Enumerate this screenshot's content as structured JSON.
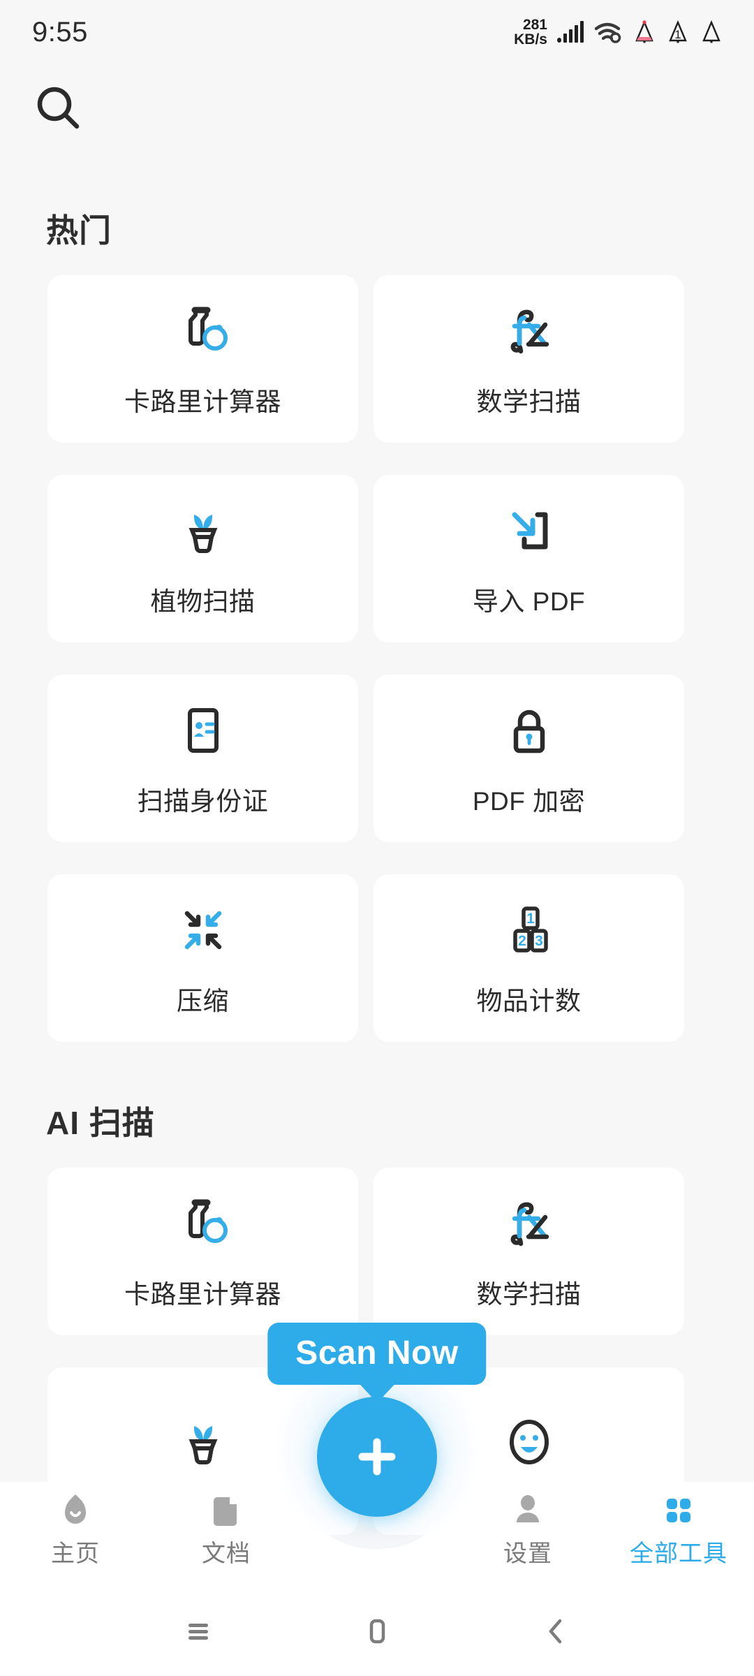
{
  "status_bar": {
    "time": "9:55",
    "net_speed_value": "281",
    "net_speed_unit": "KB/s",
    "badge_count": "1",
    "icons": [
      "signal-bars-icon",
      "wifi-icon",
      "tree-red-icon",
      "bell-badge-icon",
      "tree-outline-icon"
    ]
  },
  "top_bar": {
    "search_icon": "search-icon"
  },
  "theme": {
    "accent": "#2eace9",
    "page_bg": "#f7f7f7",
    "card_bg": "#ffffff",
    "text": "#2b2b2b",
    "muted": "#7a7a7a"
  },
  "sections": [
    {
      "title": "热门",
      "tools": [
        {
          "label": "卡路里计算器",
          "icon": "calorie-bottle-fruit-icon"
        },
        {
          "label": "数学扫描",
          "icon": "fx-math-icon"
        },
        {
          "label": "植物扫描",
          "icon": "potted-plant-icon"
        },
        {
          "label": "导入 PDF",
          "icon": "import-pdf-arrow-icon"
        },
        {
          "label": "扫描身份证",
          "icon": "id-card-icon"
        },
        {
          "label": "PDF 加密",
          "icon": "lock-icon"
        },
        {
          "label": "压缩",
          "icon": "compress-arrows-icon"
        },
        {
          "label": "物品计数",
          "icon": "count-blocks-123-icon"
        }
      ]
    },
    {
      "title": "AI 扫描",
      "tools": [
        {
          "label": "卡路里计算器",
          "icon": "calorie-bottle-fruit-icon"
        },
        {
          "label": "数学扫描",
          "icon": "fx-math-icon"
        },
        {
          "label": "",
          "icon": "potted-plant-icon"
        },
        {
          "label": "",
          "icon": "smiley-face-icon"
        }
      ]
    }
  ],
  "tooltip": {
    "text": "Scan Now"
  },
  "fab": {
    "icon": "plus-icon"
  },
  "bottom_nav": {
    "items": [
      {
        "label": "主页",
        "icon": "home-icon",
        "active": false
      },
      {
        "label": "文档",
        "icon": "document-icon",
        "active": false
      },
      {
        "label": "设置",
        "icon": "person-icon",
        "active": false
      },
      {
        "label": "全部工具",
        "icon": "grid-apps-icon",
        "active": true
      }
    ]
  },
  "android_nav": {
    "recents_icon": "recents-icon",
    "home_icon": "home-square-icon",
    "back_icon": "back-chevron-icon"
  }
}
